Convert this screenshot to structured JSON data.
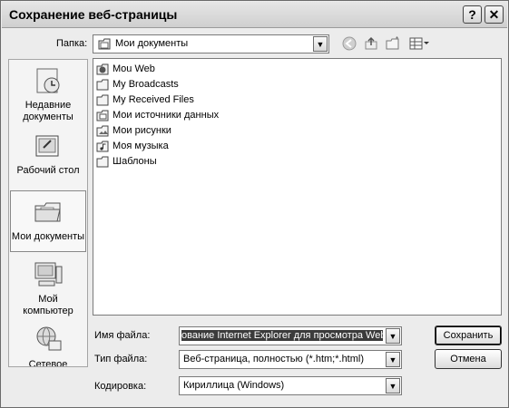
{
  "window": {
    "title": "Сохранение веб-страницы"
  },
  "toolbar": {
    "folder_label": "Папка:",
    "folder_value": "Мои документы"
  },
  "places": [
    {
      "label": "Недавние документы",
      "icon": "recent-documents-icon"
    },
    {
      "label": "Рабочий стол",
      "icon": "desktop-icon"
    },
    {
      "label": "Мои документы",
      "icon": "my-documents-icon"
    },
    {
      "label": "Мой компьютер",
      "icon": "my-computer-icon"
    },
    {
      "label": "Сетевое",
      "icon": "network-icon"
    }
  ],
  "files": [
    {
      "name": "Mou Web",
      "icon": "web-folder-icon"
    },
    {
      "name": "My Broadcasts",
      "icon": "folder-icon"
    },
    {
      "name": "My Received Files",
      "icon": "folder-icon"
    },
    {
      "name": "Мои источники данных",
      "icon": "data-sources-folder-icon"
    },
    {
      "name": "Мои рисунки",
      "icon": "pictures-folder-icon"
    },
    {
      "name": "Моя музыка",
      "icon": "music-folder-icon"
    },
    {
      "name": "Шаблоны",
      "icon": "folder-icon"
    }
  ],
  "form": {
    "filename_label": "Имя файла:",
    "filename_value": "ование Internet Explorer для просмотра Web",
    "filetype_label": "Тип файла:",
    "filetype_value": "Веб-страница, полностью (*.htm;*.html)",
    "encoding_label": "Кодировка:",
    "encoding_value": "Кириллица (Windows)"
  },
  "buttons": {
    "save": "Сохранить",
    "cancel": "Отмена"
  }
}
